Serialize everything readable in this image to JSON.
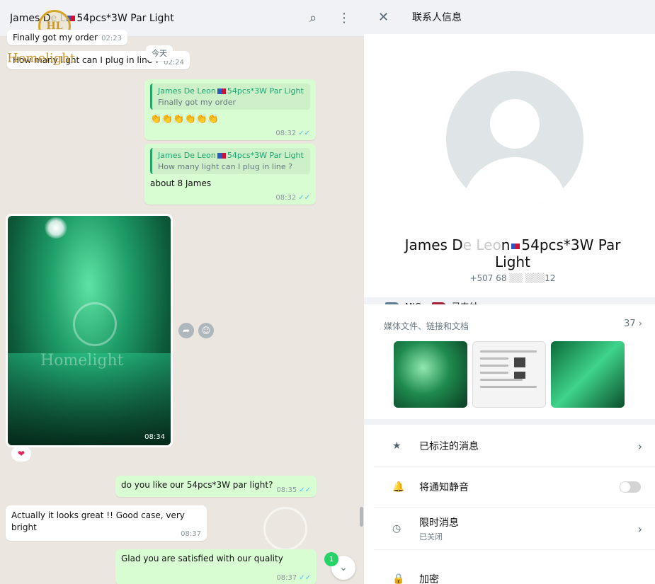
{
  "chat": {
    "header": {
      "title_prefix": "James D",
      "title_masked": "e L",
      "title_suffix": "54pcs*3W Par Light"
    },
    "day_chip": "今天",
    "brand": {
      "mark": "HL",
      "text": "Homelight"
    },
    "watermark": "Homelight",
    "messages": [
      {
        "id": "m1",
        "dir": "in",
        "text": "Finally got my order",
        "time": "02:23"
      },
      {
        "id": "m2",
        "dir": "in",
        "text": "How many light can I plug in line ?",
        "time": "02:24"
      },
      {
        "id": "m3",
        "dir": "out",
        "quote_name": "James De Leon",
        "quote_suffix": "54pcs*3W Par Light",
        "quote_text": "Finally got my order",
        "text": "👏👏👏👏👏👏",
        "time": "08:32"
      },
      {
        "id": "m4",
        "dir": "out",
        "quote_name": "James De Leon",
        "quote_suffix": "54pcs*3W Par Light",
        "quote_text": "How many light can I plug in line ?",
        "text": "about 8 James",
        "time": "08:32"
      },
      {
        "id": "m5",
        "dir": "in",
        "type": "photo",
        "time": "08:34",
        "reaction": "❤"
      },
      {
        "id": "m6",
        "dir": "out",
        "text": "do you like our 54pcs*3W par light?",
        "time": "08:35"
      },
      {
        "id": "m7",
        "dir": "in",
        "text": "Actually it looks great !! Good case, very bright",
        "time": "08:37"
      },
      {
        "id": "m8",
        "dir": "out",
        "text": "Glad you are satisfied with our quality",
        "time": "08:37"
      }
    ],
    "ticks": "✓✓",
    "unread": "1"
  },
  "info": {
    "title": "联系人信息",
    "name_prefix": "James D",
    "name_mid": "e Leo",
    "name_suffix": "n",
    "name_rest": "54pcs*3W Par Light",
    "phone": "+507 68",
    "phone_tail": "12",
    "labels": [
      {
        "text": "MIC",
        "color": "#5c7c95"
      },
      {
        "text": "已支付",
        "color": "#a3213a"
      }
    ],
    "media": {
      "heading": "媒体文件、链接和文档",
      "count": "37"
    },
    "options": [
      {
        "label": "已标注的消息",
        "icon": "star-icon",
        "glyph": "★"
      },
      {
        "label": "将通知静音",
        "icon": "bell-icon",
        "glyph": "🔔"
      },
      {
        "label": "限时消息",
        "sub": "已关闭",
        "icon": "timer-icon",
        "glyph": "◷"
      },
      {
        "label": "加密",
        "icon": "lock-icon",
        "glyph": "🔒"
      }
    ]
  },
  "colors": {
    "chat_bg": "#ebe6df",
    "out_bubble": "#d9fdd3",
    "accent": "#25d366",
    "quote_green": "#1ea472"
  }
}
